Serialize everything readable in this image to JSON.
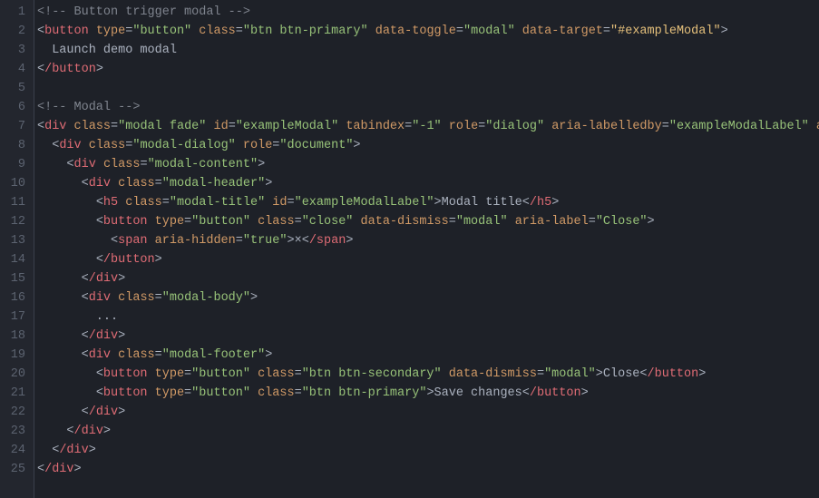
{
  "lineCount": 25,
  "code": [
    [
      {
        "t": "<!-- Button trigger modal -->",
        "c": "c-comment"
      }
    ],
    [
      {
        "t": "<",
        "c": "c-tag-bracket"
      },
      {
        "t": "button",
        "c": "c-tag-name"
      },
      {
        "t": " ",
        "c": ""
      },
      {
        "t": "type",
        "c": "c-attr-name"
      },
      {
        "t": "=",
        "c": "c-attr-eq"
      },
      {
        "t": "\"button\"",
        "c": "c-string"
      },
      {
        "t": " ",
        "c": ""
      },
      {
        "t": "class",
        "c": "c-attr-name"
      },
      {
        "t": "=",
        "c": "c-attr-eq"
      },
      {
        "t": "\"btn btn-primary\"",
        "c": "c-string"
      },
      {
        "t": " ",
        "c": ""
      },
      {
        "t": "data-toggle",
        "c": "c-attr-name"
      },
      {
        "t": "=",
        "c": "c-attr-eq"
      },
      {
        "t": "\"modal\"",
        "c": "c-string"
      },
      {
        "t": " ",
        "c": ""
      },
      {
        "t": "data-target",
        "c": "c-attr-name"
      },
      {
        "t": "=",
        "c": "c-attr-eq"
      },
      {
        "t": "\"#exampleModal\"",
        "c": "c-string-y"
      },
      {
        "t": ">",
        "c": "c-tag-bracket"
      }
    ],
    [
      {
        "t": "  Launch demo modal",
        "c": "c-text"
      }
    ],
    [
      {
        "t": "<",
        "c": "c-tag-bracket"
      },
      {
        "t": "/button",
        "c": "c-close"
      },
      {
        "t": ">",
        "c": "c-tag-bracket"
      }
    ],
    [],
    [
      {
        "t": "<!-- Modal -->",
        "c": "c-comment"
      }
    ],
    [
      {
        "t": "<",
        "c": "c-tag-bracket"
      },
      {
        "t": "div",
        "c": "c-tag-name"
      },
      {
        "t": " ",
        "c": ""
      },
      {
        "t": "class",
        "c": "c-attr-name"
      },
      {
        "t": "=",
        "c": "c-attr-eq"
      },
      {
        "t": "\"modal fade\"",
        "c": "c-string"
      },
      {
        "t": " ",
        "c": ""
      },
      {
        "t": "id",
        "c": "c-attr-name"
      },
      {
        "t": "=",
        "c": "c-attr-eq"
      },
      {
        "t": "\"exampleModal\"",
        "c": "c-string"
      },
      {
        "t": " ",
        "c": ""
      },
      {
        "t": "tabindex",
        "c": "c-attr-name"
      },
      {
        "t": "=",
        "c": "c-attr-eq"
      },
      {
        "t": "\"-1\"",
        "c": "c-string"
      },
      {
        "t": " ",
        "c": ""
      },
      {
        "t": "role",
        "c": "c-attr-name"
      },
      {
        "t": "=",
        "c": "c-attr-eq"
      },
      {
        "t": "\"dialog\"",
        "c": "c-string"
      },
      {
        "t": " ",
        "c": ""
      },
      {
        "t": "aria-labelledby",
        "c": "c-attr-name"
      },
      {
        "t": "=",
        "c": "c-attr-eq"
      },
      {
        "t": "\"exampleModalLabel\"",
        "c": "c-string"
      },
      {
        "t": " ",
        "c": ""
      },
      {
        "t": "ar",
        "c": "c-attr-name"
      }
    ],
    [
      {
        "t": "  ",
        "c": ""
      },
      {
        "t": "<",
        "c": "c-tag-bracket"
      },
      {
        "t": "div",
        "c": "c-tag-name"
      },
      {
        "t": " ",
        "c": ""
      },
      {
        "t": "class",
        "c": "c-attr-name"
      },
      {
        "t": "=",
        "c": "c-attr-eq"
      },
      {
        "t": "\"modal-dialog\"",
        "c": "c-string"
      },
      {
        "t": " ",
        "c": ""
      },
      {
        "t": "role",
        "c": "c-attr-name"
      },
      {
        "t": "=",
        "c": "c-attr-eq"
      },
      {
        "t": "\"document\"",
        "c": "c-string"
      },
      {
        "t": ">",
        "c": "c-tag-bracket"
      }
    ],
    [
      {
        "t": "    ",
        "c": ""
      },
      {
        "t": "<",
        "c": "c-tag-bracket"
      },
      {
        "t": "div",
        "c": "c-tag-name"
      },
      {
        "t": " ",
        "c": ""
      },
      {
        "t": "class",
        "c": "c-attr-name"
      },
      {
        "t": "=",
        "c": "c-attr-eq"
      },
      {
        "t": "\"modal-content\"",
        "c": "c-string"
      },
      {
        "t": ">",
        "c": "c-tag-bracket"
      }
    ],
    [
      {
        "t": "      ",
        "c": ""
      },
      {
        "t": "<",
        "c": "c-tag-bracket"
      },
      {
        "t": "div",
        "c": "c-tag-name"
      },
      {
        "t": " ",
        "c": ""
      },
      {
        "t": "class",
        "c": "c-attr-name"
      },
      {
        "t": "=",
        "c": "c-attr-eq"
      },
      {
        "t": "\"modal-header\"",
        "c": "c-string"
      },
      {
        "t": ">",
        "c": "c-tag-bracket"
      }
    ],
    [
      {
        "t": "        ",
        "c": ""
      },
      {
        "t": "<",
        "c": "c-tag-bracket"
      },
      {
        "t": "h5",
        "c": "c-tag-name"
      },
      {
        "t": " ",
        "c": ""
      },
      {
        "t": "class",
        "c": "c-attr-name"
      },
      {
        "t": "=",
        "c": "c-attr-eq"
      },
      {
        "t": "\"modal-title\"",
        "c": "c-string"
      },
      {
        "t": " ",
        "c": ""
      },
      {
        "t": "id",
        "c": "c-attr-name"
      },
      {
        "t": "=",
        "c": "c-attr-eq"
      },
      {
        "t": "\"exampleModalLabel\"",
        "c": "c-string"
      },
      {
        "t": ">",
        "c": "c-tag-bracket"
      },
      {
        "t": "Modal title",
        "c": "c-text"
      },
      {
        "t": "<",
        "c": "c-tag-bracket"
      },
      {
        "t": "/h5",
        "c": "c-close"
      },
      {
        "t": ">",
        "c": "c-tag-bracket"
      }
    ],
    [
      {
        "t": "        ",
        "c": ""
      },
      {
        "t": "<",
        "c": "c-tag-bracket"
      },
      {
        "t": "button",
        "c": "c-tag-name"
      },
      {
        "t": " ",
        "c": ""
      },
      {
        "t": "type",
        "c": "c-attr-name"
      },
      {
        "t": "=",
        "c": "c-attr-eq"
      },
      {
        "t": "\"button\"",
        "c": "c-string"
      },
      {
        "t": " ",
        "c": ""
      },
      {
        "t": "class",
        "c": "c-attr-name"
      },
      {
        "t": "=",
        "c": "c-attr-eq"
      },
      {
        "t": "\"close\"",
        "c": "c-string"
      },
      {
        "t": " ",
        "c": ""
      },
      {
        "t": "data-dismiss",
        "c": "c-attr-name"
      },
      {
        "t": "=",
        "c": "c-attr-eq"
      },
      {
        "t": "\"modal\"",
        "c": "c-string"
      },
      {
        "t": " ",
        "c": ""
      },
      {
        "t": "aria-label",
        "c": "c-attr-name"
      },
      {
        "t": "=",
        "c": "c-attr-eq"
      },
      {
        "t": "\"Close\"",
        "c": "c-string"
      },
      {
        "t": ">",
        "c": "c-tag-bracket"
      }
    ],
    [
      {
        "t": "          ",
        "c": ""
      },
      {
        "t": "<",
        "c": "c-tag-bracket"
      },
      {
        "t": "span",
        "c": "c-tag-name"
      },
      {
        "t": " ",
        "c": ""
      },
      {
        "t": "aria-hidden",
        "c": "c-attr-name"
      },
      {
        "t": "=",
        "c": "c-attr-eq"
      },
      {
        "t": "\"true\"",
        "c": "c-string"
      },
      {
        "t": ">",
        "c": "c-tag-bracket"
      },
      {
        "t": "×",
        "c": "c-text"
      },
      {
        "t": "<",
        "c": "c-tag-bracket"
      },
      {
        "t": "/span",
        "c": "c-close"
      },
      {
        "t": ">",
        "c": "c-tag-bracket"
      }
    ],
    [
      {
        "t": "        ",
        "c": ""
      },
      {
        "t": "<",
        "c": "c-tag-bracket"
      },
      {
        "t": "/button",
        "c": "c-close"
      },
      {
        "t": ">",
        "c": "c-tag-bracket"
      }
    ],
    [
      {
        "t": "      ",
        "c": ""
      },
      {
        "t": "<",
        "c": "c-tag-bracket"
      },
      {
        "t": "/div",
        "c": "c-close"
      },
      {
        "t": ">",
        "c": "c-tag-bracket"
      }
    ],
    [
      {
        "t": "      ",
        "c": ""
      },
      {
        "t": "<",
        "c": "c-tag-bracket"
      },
      {
        "t": "div",
        "c": "c-tag-name"
      },
      {
        "t": " ",
        "c": ""
      },
      {
        "t": "class",
        "c": "c-attr-name"
      },
      {
        "t": "=",
        "c": "c-attr-eq"
      },
      {
        "t": "\"modal-body\"",
        "c": "c-string"
      },
      {
        "t": ">",
        "c": "c-tag-bracket"
      }
    ],
    [
      {
        "t": "        ...",
        "c": "c-text"
      }
    ],
    [
      {
        "t": "      ",
        "c": ""
      },
      {
        "t": "<",
        "c": "c-tag-bracket"
      },
      {
        "t": "/div",
        "c": "c-close"
      },
      {
        "t": ">",
        "c": "c-tag-bracket"
      }
    ],
    [
      {
        "t": "      ",
        "c": ""
      },
      {
        "t": "<",
        "c": "c-tag-bracket"
      },
      {
        "t": "div",
        "c": "c-tag-name"
      },
      {
        "t": " ",
        "c": ""
      },
      {
        "t": "class",
        "c": "c-attr-name"
      },
      {
        "t": "=",
        "c": "c-attr-eq"
      },
      {
        "t": "\"modal-footer\"",
        "c": "c-string"
      },
      {
        "t": ">",
        "c": "c-tag-bracket"
      }
    ],
    [
      {
        "t": "        ",
        "c": ""
      },
      {
        "t": "<",
        "c": "c-tag-bracket"
      },
      {
        "t": "button",
        "c": "c-tag-name"
      },
      {
        "t": " ",
        "c": ""
      },
      {
        "t": "type",
        "c": "c-attr-name"
      },
      {
        "t": "=",
        "c": "c-attr-eq"
      },
      {
        "t": "\"button\"",
        "c": "c-string"
      },
      {
        "t": " ",
        "c": ""
      },
      {
        "t": "class",
        "c": "c-attr-name"
      },
      {
        "t": "=",
        "c": "c-attr-eq"
      },
      {
        "t": "\"btn btn-secondary\"",
        "c": "c-string"
      },
      {
        "t": " ",
        "c": ""
      },
      {
        "t": "data-dismiss",
        "c": "c-attr-name"
      },
      {
        "t": "=",
        "c": "c-attr-eq"
      },
      {
        "t": "\"modal\"",
        "c": "c-string"
      },
      {
        "t": ">",
        "c": "c-tag-bracket"
      },
      {
        "t": "Close",
        "c": "c-text"
      },
      {
        "t": "<",
        "c": "c-tag-bracket"
      },
      {
        "t": "/button",
        "c": "c-close"
      },
      {
        "t": ">",
        "c": "c-tag-bracket"
      }
    ],
    [
      {
        "t": "        ",
        "c": ""
      },
      {
        "t": "<",
        "c": "c-tag-bracket"
      },
      {
        "t": "button",
        "c": "c-tag-name"
      },
      {
        "t": " ",
        "c": ""
      },
      {
        "t": "type",
        "c": "c-attr-name"
      },
      {
        "t": "=",
        "c": "c-attr-eq"
      },
      {
        "t": "\"button\"",
        "c": "c-string"
      },
      {
        "t": " ",
        "c": ""
      },
      {
        "t": "class",
        "c": "c-attr-name"
      },
      {
        "t": "=",
        "c": "c-attr-eq"
      },
      {
        "t": "\"btn btn-primary\"",
        "c": "c-string"
      },
      {
        "t": ">",
        "c": "c-tag-bracket"
      },
      {
        "t": "Save changes",
        "c": "c-text"
      },
      {
        "t": "<",
        "c": "c-tag-bracket"
      },
      {
        "t": "/button",
        "c": "c-close"
      },
      {
        "t": ">",
        "c": "c-tag-bracket"
      }
    ],
    [
      {
        "t": "      ",
        "c": ""
      },
      {
        "t": "<",
        "c": "c-tag-bracket"
      },
      {
        "t": "/div",
        "c": "c-close"
      },
      {
        "t": ">",
        "c": "c-tag-bracket"
      }
    ],
    [
      {
        "t": "    ",
        "c": ""
      },
      {
        "t": "<",
        "c": "c-tag-bracket"
      },
      {
        "t": "/div",
        "c": "c-close"
      },
      {
        "t": ">",
        "c": "c-tag-bracket"
      }
    ],
    [
      {
        "t": "  ",
        "c": ""
      },
      {
        "t": "<",
        "c": "c-tag-bracket"
      },
      {
        "t": "/div",
        "c": "c-close"
      },
      {
        "t": ">",
        "c": "c-tag-bracket"
      }
    ],
    [
      {
        "t": "<",
        "c": "c-tag-bracket"
      },
      {
        "t": "/div",
        "c": "c-close"
      },
      {
        "t": ">",
        "c": "c-tag-bracket"
      }
    ]
  ]
}
